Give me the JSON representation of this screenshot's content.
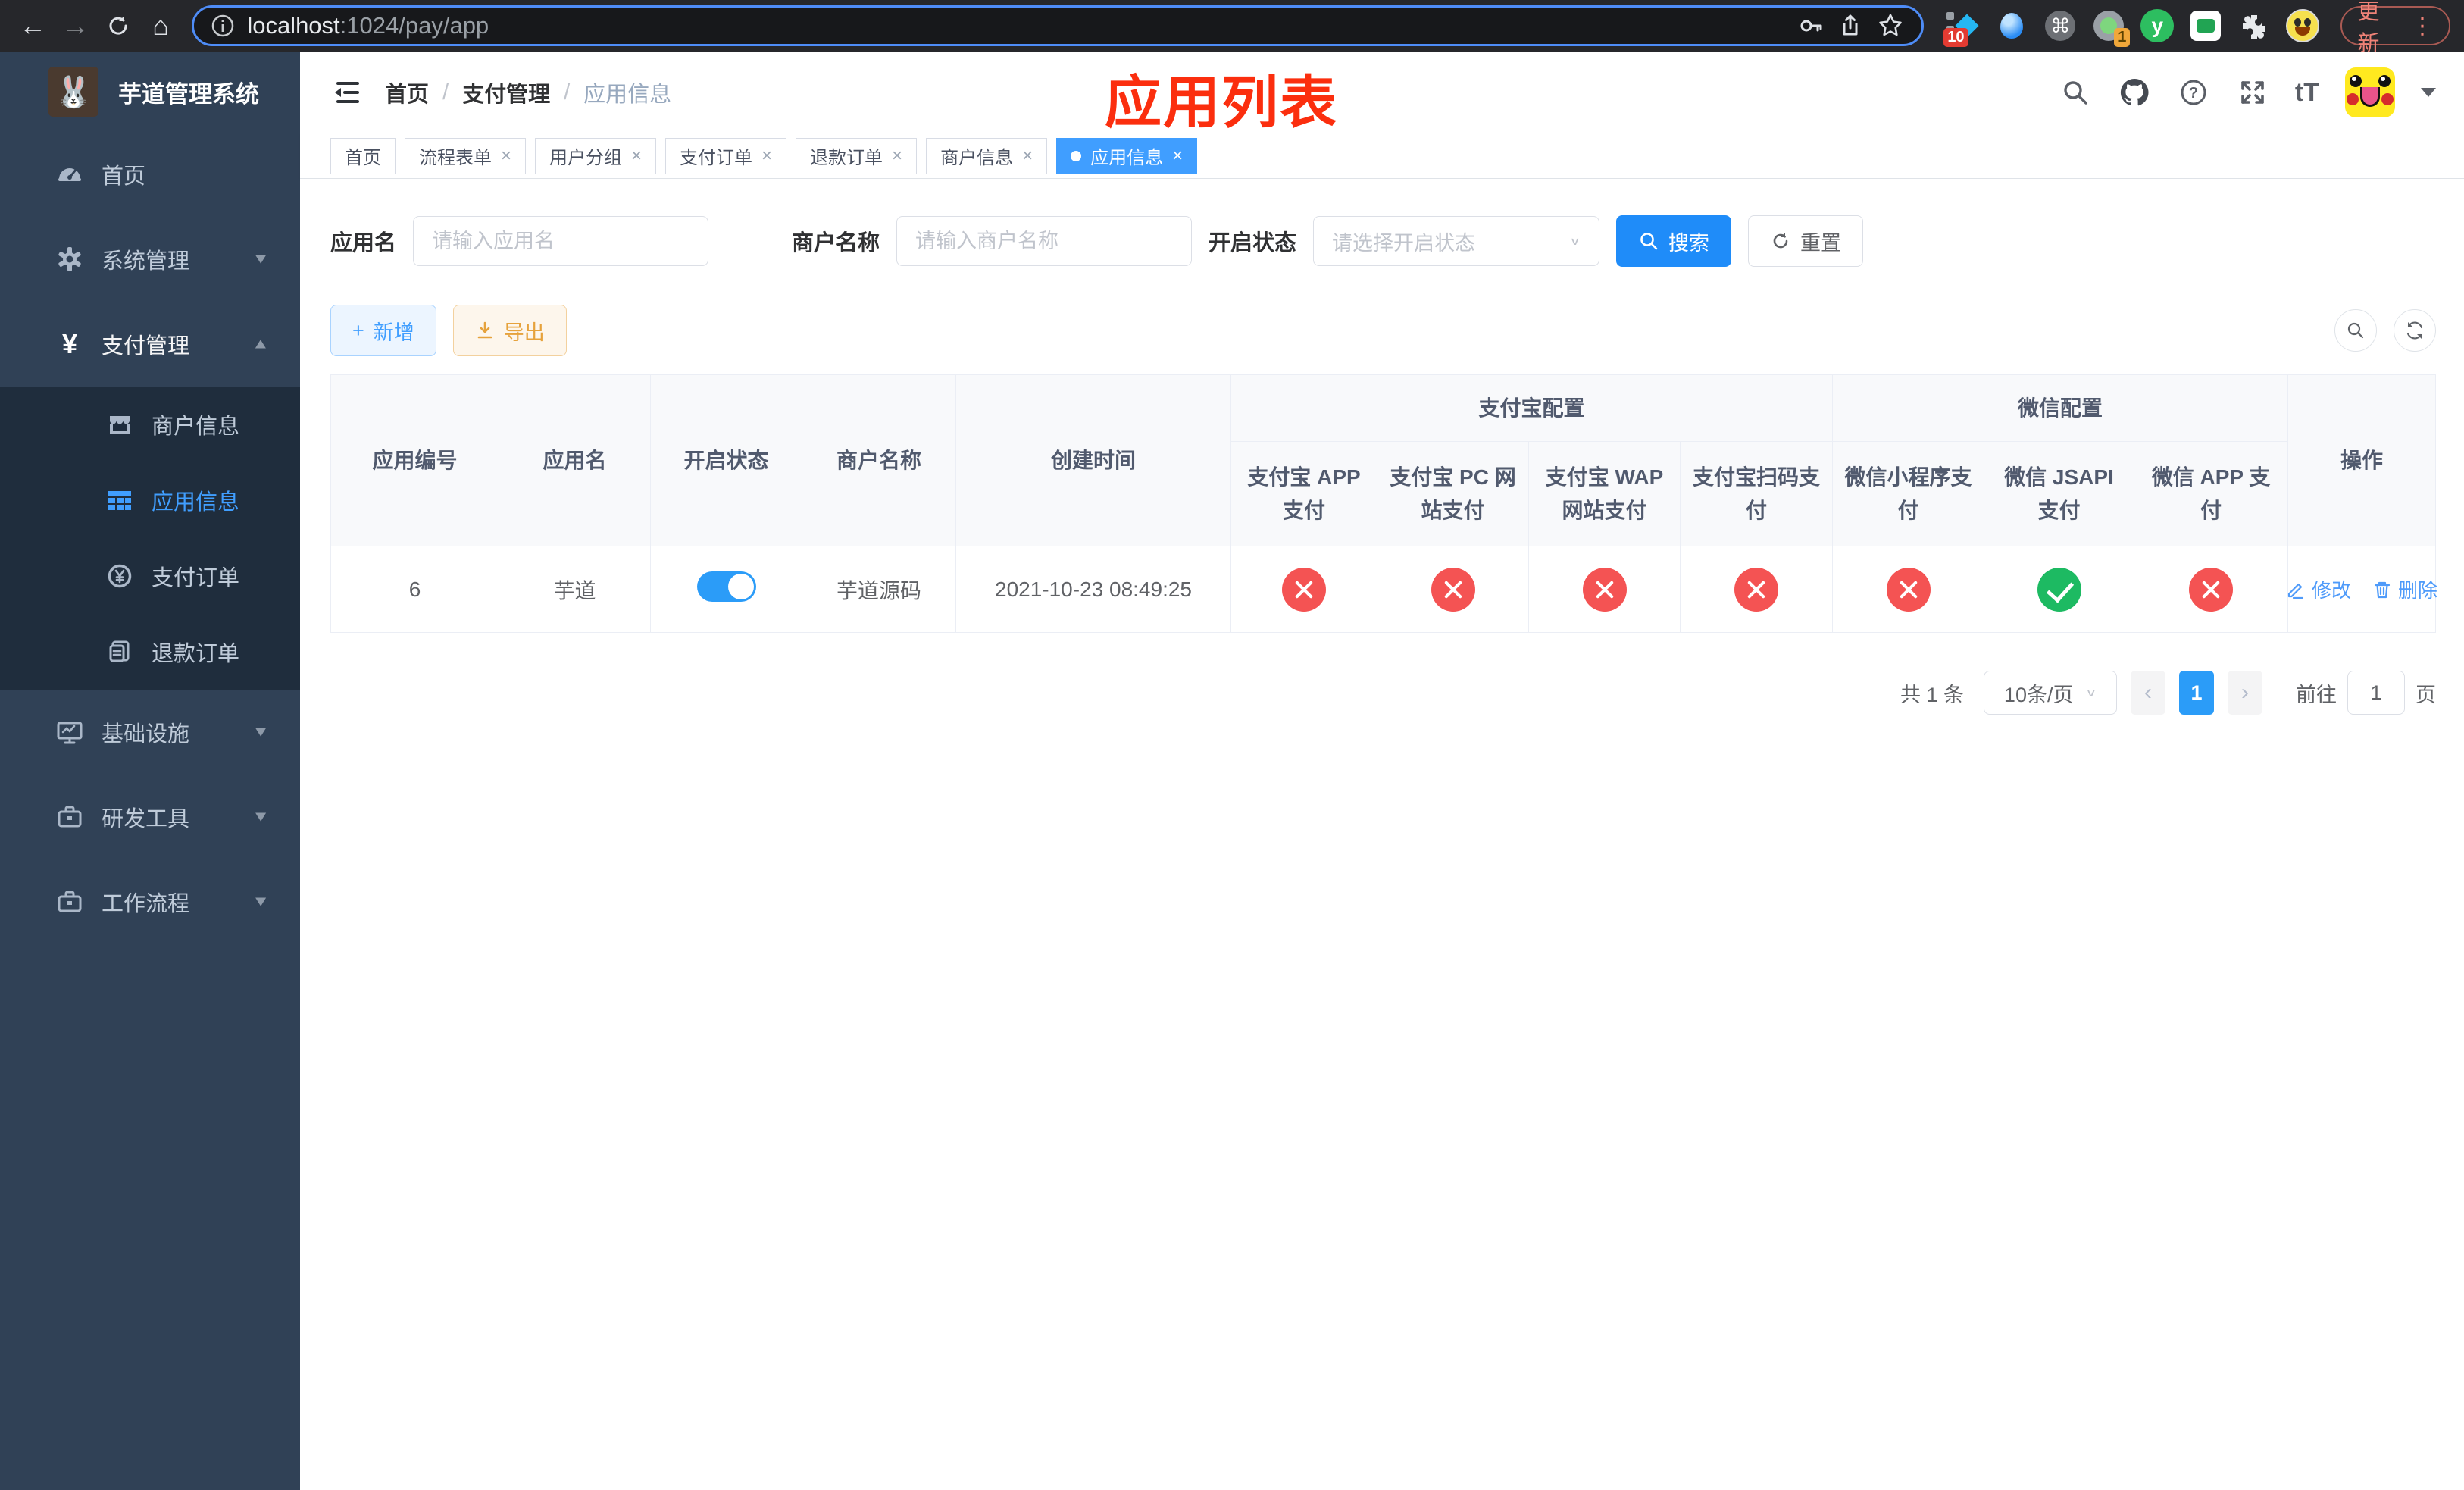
{
  "browser": {
    "url_host": "localhost",
    "url_path": ":1024/pay/app",
    "update_label": "更新",
    "kebab_glyph": "⋮",
    "ext_badge_blue_diamond": "10",
    "ext_badge_recorder": "1",
    "ext_y_letter": "y",
    "ext_command_glyph": "⌘"
  },
  "sidebar": {
    "title": "芋道管理系统",
    "home": "首页",
    "system": "系统管理",
    "payment": "支付管理",
    "merchant": "商户信息",
    "app_info": "应用信息",
    "pay_order": "支付订单",
    "refund_order": "退款订单",
    "infra": "基础设施",
    "dev_tools": "研发工具",
    "workflow": "工作流程",
    "yen_glyph": "¥"
  },
  "header": {
    "breadcrumb_1": "首页",
    "breadcrumb_2": "支付管理",
    "breadcrumb_3": "应用信息",
    "separator": "/",
    "annotation": "应用列表",
    "font_icon_label": "tT"
  },
  "tabs": [
    {
      "label": "首页",
      "closable": false,
      "active": false
    },
    {
      "label": "流程表单",
      "closable": true,
      "active": false
    },
    {
      "label": "用户分组",
      "closable": true,
      "active": false
    },
    {
      "label": "支付订单",
      "closable": true,
      "active": false
    },
    {
      "label": "退款订单",
      "closable": true,
      "active": false
    },
    {
      "label": "商户信息",
      "closable": true,
      "active": false
    },
    {
      "label": "应用信息",
      "closable": true,
      "active": true
    }
  ],
  "ui": {
    "close_glyph": "×",
    "plus_glyph": "+",
    "prev_glyph": "‹",
    "next_glyph": "›",
    "caret_glyph": "∨"
  },
  "filters": {
    "app_name_label": "应用名",
    "app_name_placeholder": "请输入应用名",
    "merchant_label": "商户名称",
    "merchant_placeholder": "请输入商户名称",
    "status_label": "开启状态",
    "status_placeholder": "请选择开启状态",
    "search_label": "搜索",
    "reset_label": "重置"
  },
  "toolbar": {
    "add_label": "新增",
    "export_label": "导出"
  },
  "table": {
    "col_app_id": "应用编号",
    "col_app_name": "应用名",
    "col_status": "开启状态",
    "col_merchant": "商户名称",
    "col_created": "创建时间",
    "group_alipay": "支付宝配置",
    "group_wechat": "微信配置",
    "col_alipay_app": "支付宝 APP 支付",
    "col_alipay_pc": "支付宝 PC 网站支付",
    "col_alipay_wap": "支付宝 WAP 网站支付",
    "col_alipay_qr": "支付宝扫码支付",
    "col_wx_mini": "微信小程序支付",
    "col_wx_jsapi": "微信 JSAPI 支付",
    "col_wx_app": "微信 APP 支付",
    "col_op": "操作",
    "rows": [
      {
        "app_id": "6",
        "app_name": "芋道",
        "enabled": true,
        "merchant_name": "芋道源码",
        "create_time": "2021-10-23 08:49:25",
        "statuses": [
          "no",
          "no",
          "no",
          "no",
          "no",
          "yes",
          "no"
        ],
        "edit_label": "修改",
        "delete_label": "删除"
      }
    ]
  },
  "pagination": {
    "total": "共 1 条",
    "page_size": "10条/页",
    "current_page": "1",
    "goto_label": "前往",
    "goto_value": "1",
    "unit_label": "页"
  },
  "colors": {
    "accent": "#409eff",
    "sidebar_bg": "#304156",
    "submenu_bg": "#1f2d3d",
    "success": "#1dba62",
    "danger": "#f45353",
    "warning": "#e6a23c",
    "annotation_red": "#fb2e0e"
  }
}
